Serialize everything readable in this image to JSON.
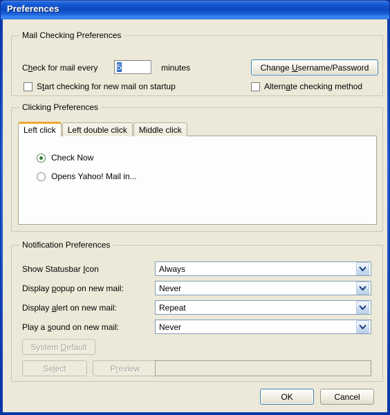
{
  "window": {
    "title": "Preferences"
  },
  "mail_checking": {
    "legend": "Mail Checking Preferences",
    "check_every_label_pre": "C",
    "check_every_label_accel": "h",
    "check_every_label_post": "eck for mail every",
    "interval_value": "5",
    "minutes_label": "minutes",
    "change_credentials_button": {
      "pre": "Change ",
      "accel": "U",
      "post": "sername/Password"
    },
    "startup_checkbox": {
      "pre": "S",
      "accel": "t",
      "post": "art checking for new mail on startup",
      "checked": false
    },
    "alternate_checkbox": {
      "pre": "Altern",
      "accel": "a",
      "post": "te checking method",
      "checked": false
    }
  },
  "clicking": {
    "legend": "Clicking Preferences",
    "tabs": [
      {
        "label": "Left click",
        "active": true
      },
      {
        "label": "Left double click",
        "active": false
      },
      {
        "label": "Middle click",
        "active": false
      }
    ],
    "options": [
      {
        "label": "Check Now",
        "selected": true
      },
      {
        "label": "Opens Yahoo! Mail in...",
        "selected": false
      }
    ]
  },
  "notification": {
    "legend": "Notification Preferences",
    "rows": [
      {
        "label_pre": "Show Statusbar ",
        "label_accel": "I",
        "label_post": "con",
        "value": "Always"
      },
      {
        "label_pre": "Display ",
        "label_accel": "p",
        "label_post": "opup on new mail:",
        "value": "Never"
      },
      {
        "label_pre": "Display ",
        "label_accel": "a",
        "label_post": "lert on new mail:",
        "value": "Repeat"
      },
      {
        "label_pre": "Play a ",
        "label_accel": "s",
        "label_post": "ound on new mail:",
        "value": "Never"
      }
    ],
    "system_default_button": {
      "pre": "System ",
      "accel": "D",
      "post": "efault",
      "disabled": true
    },
    "select_button": {
      "pre": "Se",
      "accel": "l",
      "post": "ect",
      "disabled": true
    },
    "preview_button": {
      "pre": "P",
      "accel": "r",
      "post": "eview",
      "disabled": true
    },
    "sound_path_value": ""
  },
  "footer": {
    "ok_label": "OK",
    "cancel_label": "Cancel"
  },
  "colors": {
    "face": "#ece9d8",
    "title_blue": "#1558d2",
    "accent_orange": "#f0a732",
    "radio_green": "#2e7d32",
    "selection_blue": "#316ac5",
    "default_border": "#3c7fb1"
  }
}
